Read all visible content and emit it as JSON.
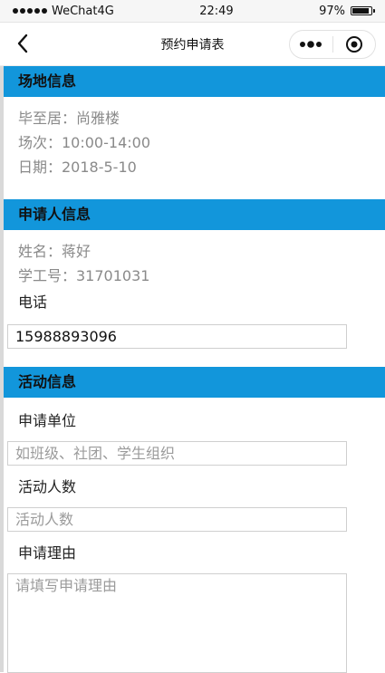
{
  "status_bar": {
    "carrier": "WeChat4G",
    "time": "22:49",
    "battery": "97%"
  },
  "nav": {
    "title": "预约申请表"
  },
  "venue": {
    "header": "场地信息",
    "lines": [
      "毕至居：尚雅楼",
      "场次：10:00-14:00",
      "日期：2018-5-10"
    ]
  },
  "applicant": {
    "header": "申请人信息",
    "lines": [
      "姓名：蒋好",
      "学工号：31701031"
    ],
    "phone_label": "电话",
    "phone_value": "15988893096"
  },
  "activity": {
    "header": "活动信息",
    "unit_label": "申请单位",
    "unit_placeholder": "如班级、社团、学生组织",
    "people_label": "活动人数",
    "people_placeholder": "活动人数",
    "reason_label": "申请理由",
    "reason_placeholder": "请填写申请理由"
  },
  "colors": {
    "header_bg": "#1296db"
  }
}
